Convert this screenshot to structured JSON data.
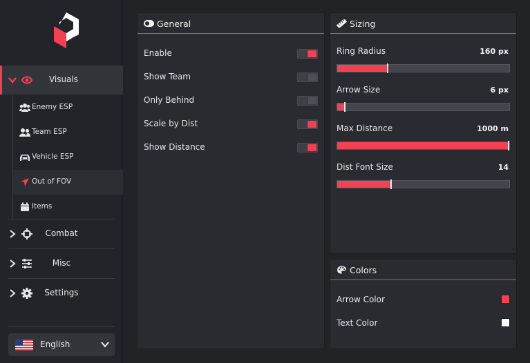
{
  "colors": {
    "accent": "#f24152",
    "bg": "#222327",
    "panel": "#2a2b30"
  },
  "sidebar": {
    "logo": "logo-icon",
    "categories": [
      {
        "label": "Visuals",
        "icon": "eye-icon",
        "expanded": true
      },
      {
        "label": "Combat",
        "icon": "crosshair-icon",
        "expanded": false
      },
      {
        "label": "Misc",
        "icon": "sliders-icon",
        "expanded": false
      },
      {
        "label": "Settings",
        "icon": "gear-icon",
        "expanded": false
      }
    ],
    "sub_items": [
      {
        "label": "Enemy ESP",
        "icon": "users-group-icon"
      },
      {
        "label": "Team ESP",
        "icon": "users-icon"
      },
      {
        "label": "Vehicle ESP",
        "icon": "car-icon"
      },
      {
        "label": "Out of FOV",
        "icon": "location-arrow-icon"
      },
      {
        "label": "Items",
        "icon": "box-icon"
      }
    ],
    "language": {
      "label": "English",
      "icon": "us-flag-icon"
    }
  },
  "general": {
    "title": "General",
    "rows": [
      {
        "label": "Enable",
        "on": true
      },
      {
        "label": "Show Team",
        "on": false
      },
      {
        "label": "Only Behind",
        "on": false
      },
      {
        "label": "Scale by Dist",
        "on": true
      },
      {
        "label": "Show Distance",
        "on": true
      }
    ]
  },
  "sizing": {
    "title": "Sizing",
    "sliders": [
      {
        "label": "Ring Radius",
        "value": "160 px",
        "fraction": 0.29
      },
      {
        "label": "Arrow Size",
        "value": "6 px",
        "fraction": 0.04
      },
      {
        "label": "Max Distance",
        "value": "1000 m",
        "fraction": 1.0
      },
      {
        "label": "Dist Font Size",
        "value": "14",
        "fraction": 0.31
      }
    ]
  },
  "colors_panel": {
    "title": "Colors",
    "items": [
      {
        "label": "Arrow Color",
        "color": "#f24152"
      },
      {
        "label": "Text Color",
        "color": "#ffffff"
      }
    ]
  }
}
